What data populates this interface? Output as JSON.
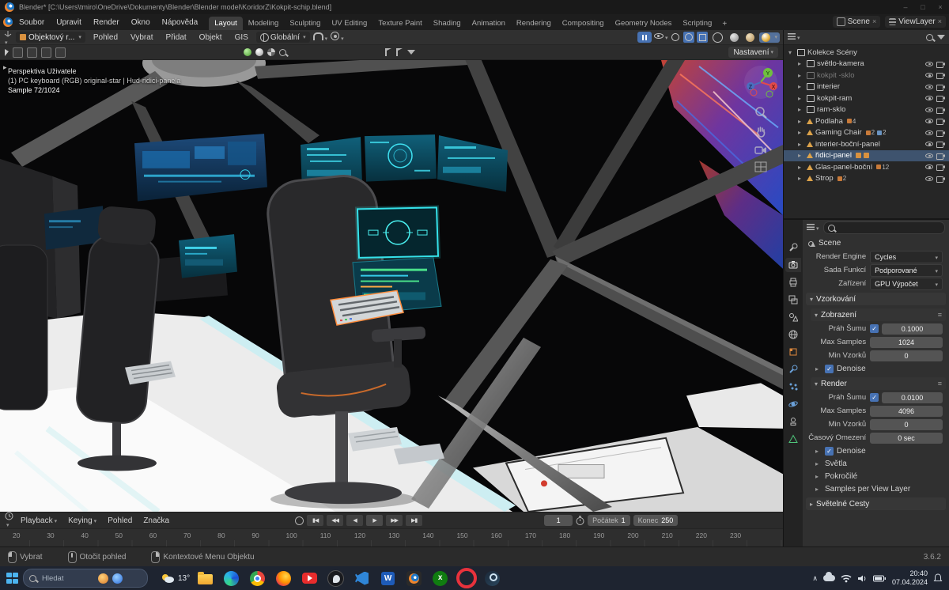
{
  "window": {
    "title": "Blender* [C:\\Users\\tmiro\\OneDrive\\Dokumenty\\Blender\\Blender model\\KoridorZ\\Kokpit-schip.blend]"
  },
  "topbar": {
    "menus": [
      "Soubor",
      "Upravit",
      "Render",
      "Okno",
      "Nápověda"
    ],
    "workspaces": [
      "Layout",
      "Modeling",
      "Sculpting",
      "UV Editing",
      "Texture Paint",
      "Shading",
      "Animation",
      "Rendering",
      "Compositing",
      "Geometry Nodes",
      "Scripting"
    ],
    "add_workspace": "+",
    "scene_name": "Scene",
    "view_layer_name": "ViewLayer"
  },
  "viewport_header": {
    "mode": "Objektový r...",
    "menus": [
      "Pohled",
      "Vybrat",
      "Přidat",
      "Objekt",
      "GIS"
    ],
    "orientation": "Globální",
    "settings_button": "Nastavení"
  },
  "viewport": {
    "overlay_line1": "Perspektiva Uživatele",
    "overlay_line2": "(1) PC keyboard (RGB) original-star | Hud-ridici-panela",
    "overlay_line3": "Sample 72/1024",
    "axis_x": "X",
    "axis_y": "Y",
    "axis_z": "Z"
  },
  "outliner": {
    "root_label": "Kolekce Scény",
    "items": [
      {
        "label": "světlo-kamera"
      },
      {
        "label": "kokpit -sklo"
      },
      {
        "label": "interier"
      },
      {
        "label": "kokpit-ram"
      },
      {
        "label": "ram-sklo"
      },
      {
        "label": "Podlaha",
        "badge": "4"
      },
      {
        "label": "Gaming Chair",
        "badge": "2",
        "badge2": "2"
      },
      {
        "label": "interier-boční-panel"
      },
      {
        "label": "řidici-panel"
      },
      {
        "label": "Glas-panel-boční",
        "badge": "12"
      },
      {
        "label": "Strop",
        "badge": "2"
      }
    ]
  },
  "properties": {
    "breadcrumb": "Scene",
    "render_engine_label": "Render Engine",
    "render_engine_value": "Cycles",
    "feature_set_label": "Sada Funkcí",
    "feature_set_value": "Podporované",
    "device_label": "Zařízení",
    "device_value": "GPU Výpočet",
    "section_sampling": "Vzorkování",
    "sub_viewport": "Zobrazení",
    "sub_render": "Render",
    "noise_threshold_label": "Práh Šumu",
    "vp_noise_threshold": "0.1000",
    "max_samples_label": "Max Samples",
    "vp_max_samples": "1024",
    "min_samples_label": "Min Vzorků",
    "vp_min_samples": "0",
    "denoise_label": "Denoise",
    "r_noise_threshold": "0.0100",
    "r_max_samples": "4096",
    "r_min_samples": "0",
    "time_limit_label": "Časový Omezení",
    "time_limit_value": "0 sec",
    "section_lights": "Světla",
    "section_advanced": "Pokročilé",
    "section_pvl": "Samples per View Layer",
    "section_light_paths": "Světelné Cesty"
  },
  "timeline": {
    "menus": [
      "Playback",
      "Keying",
      "Pohled",
      "Značka"
    ],
    "transport": [
      "▮◀",
      "◀◀",
      "◀",
      "▶",
      "▶▶",
      "▶▮"
    ],
    "current_frame": "1",
    "start_label": "Počátek",
    "start_value": "1",
    "end_label": "Konec",
    "end_value": "250",
    "ticks": [
      "20",
      "30",
      "40",
      "50",
      "60",
      "70",
      "80",
      "90",
      "100",
      "110",
      "120",
      "130",
      "140",
      "150",
      "160",
      "170",
      "180",
      "190",
      "200",
      "210",
      "220",
      "230"
    ]
  },
  "status_bar": {
    "select_hint": "Vybrat",
    "rotate_hint": "Otočit pohled",
    "context_hint": "Kontextové Menu Objektu",
    "version": "3.6.2"
  },
  "taskbar": {
    "search_placeholder": "Hledat",
    "weather_temp": "13°",
    "apps": [
      "folder",
      "edge",
      "chrome",
      "firefox",
      "youtube",
      "obs",
      "vscode",
      "word",
      "blender",
      "xbox",
      "opera",
      "steam"
    ],
    "time": "20:40",
    "date": "07.04.2024"
  },
  "colors": {
    "accent_blue": "#4772b3",
    "cyan_screen": "#35dbe8",
    "selection_orange": "#ff8c3c"
  }
}
